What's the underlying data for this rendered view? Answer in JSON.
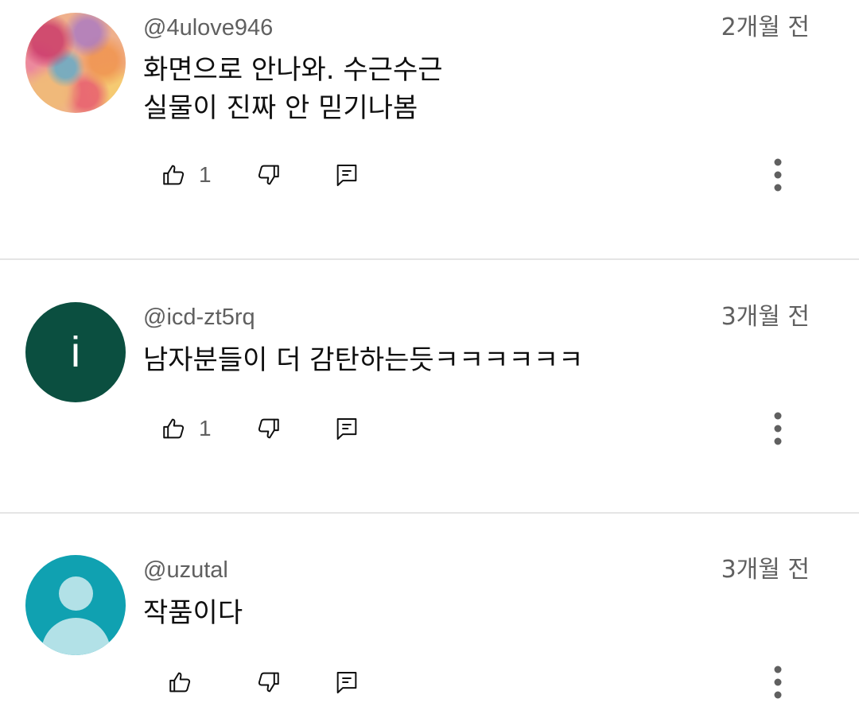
{
  "comments": [
    {
      "handle": "@4ulove946",
      "time": "2개월 전",
      "lines": [
        "화면으로 안나와. 수근수근",
        "실물이 진짜 안 믿기나봄"
      ],
      "like_count": "1",
      "avatar": {
        "type": "mosaic-image"
      }
    },
    {
      "handle": "@icd-zt5rq",
      "time": "3개월 전",
      "lines": [
        "남자분들이 더 감탄하는듯ㅋㅋㅋㅋㅋㅋ"
      ],
      "like_count": "1",
      "avatar": {
        "type": "letter",
        "letter": "i",
        "color": "#0b4f40"
      }
    },
    {
      "handle": "@uzutal",
      "time": "3개월 전",
      "lines": [
        "작품이다"
      ],
      "like_count": "",
      "avatar": {
        "type": "default-person",
        "color": "#10a1b1"
      }
    }
  ],
  "icons": {
    "like": "thumbs-up-icon",
    "dislike": "thumbs-down-icon",
    "reply": "reply-comment-icon",
    "more": "more-vertical-icon"
  },
  "colors": {
    "secondary_text": "#606060",
    "primary_text": "#0f0f0f",
    "divider": "#e5e5e5"
  }
}
